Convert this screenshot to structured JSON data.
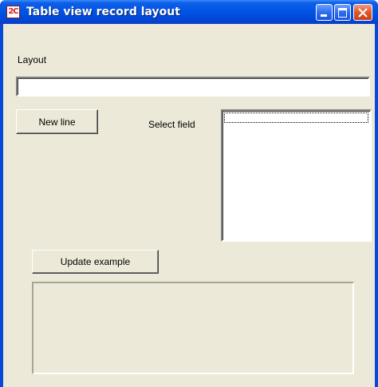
{
  "window": {
    "title": "Table view record layout",
    "app_icon_text": "2C",
    "buttons": [
      "minimize",
      "maximize",
      "close"
    ]
  },
  "form": {
    "layout_label": "Layout",
    "layout_value": "",
    "new_line_label": "New line",
    "select_field_label": "Select field",
    "field_list_items": [],
    "update_example_label": "Update example",
    "example_text": ""
  },
  "colors": {
    "titlebar": "#0055e5",
    "client_bg": "#ece9d8",
    "close_button": "#e0562c"
  }
}
